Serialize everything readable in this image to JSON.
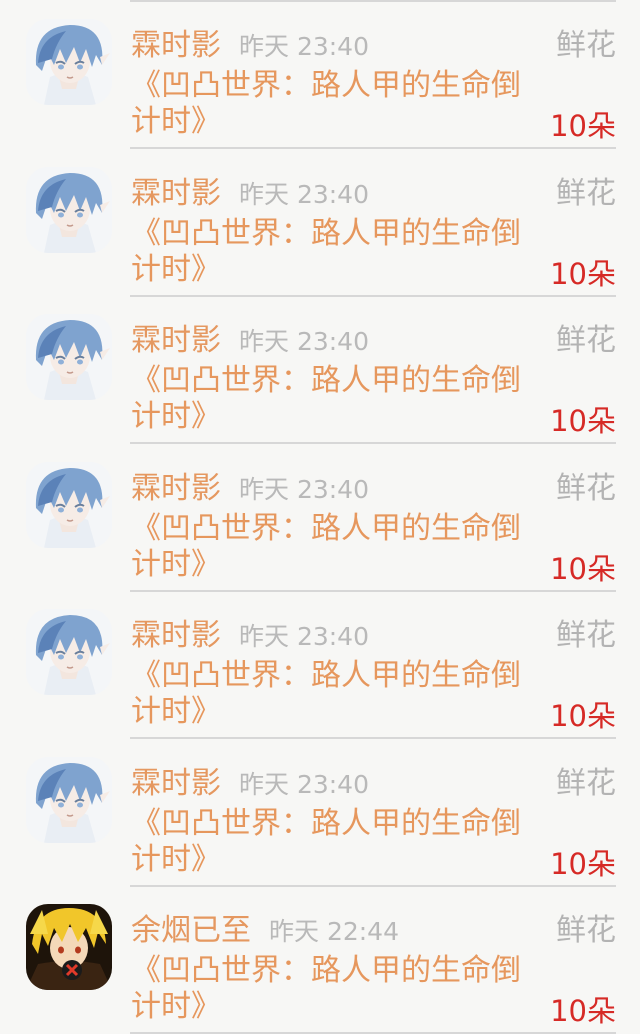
{
  "gifts": [
    {
      "user": "霖时影",
      "time": "昨天 23:40",
      "gift_label": "鲜花",
      "work_title": "《凹凸世界：路人甲的生命倒计时》",
      "count": "10朵",
      "avatar": "blue-hair-avatar"
    },
    {
      "user": "霖时影",
      "time": "昨天 23:40",
      "gift_label": "鲜花",
      "work_title": "《凹凸世界：路人甲的生命倒计时》",
      "count": "10朵",
      "avatar": "blue-hair-avatar"
    },
    {
      "user": "霖时影",
      "time": "昨天 23:40",
      "gift_label": "鲜花",
      "work_title": "《凹凸世界：路人甲的生命倒计时》",
      "count": "10朵",
      "avatar": "blue-hair-avatar"
    },
    {
      "user": "霖时影",
      "time": "昨天 23:40",
      "gift_label": "鲜花",
      "work_title": "《凹凸世界：路人甲的生命倒计时》",
      "count": "10朵",
      "avatar": "blue-hair-avatar"
    },
    {
      "user": "霖时影",
      "time": "昨天 23:40",
      "gift_label": "鲜花",
      "work_title": "《凹凸世界：路人甲的生命倒计时》",
      "count": "10朵",
      "avatar": "blue-hair-avatar"
    },
    {
      "user": "霖时影",
      "time": "昨天 23:40",
      "gift_label": "鲜花",
      "work_title": "《凹凸世界：路人甲的生命倒计时》",
      "count": "10朵",
      "avatar": "blue-hair-avatar"
    },
    {
      "user": "余烟已至",
      "time": "昨天 22:44",
      "gift_label": "鲜花",
      "work_title": "《凹凸世界：路人甲的生命倒计时》",
      "count": "10朵",
      "avatar": "yellow-hair-avatar"
    }
  ],
  "colors": {
    "user_name": "#e59860",
    "time": "#b9b9b9",
    "gift_label": "#b3b3b3",
    "work_title": "#e6975d",
    "gift_count": "#d62a26",
    "divider": "#d7d7d7",
    "background": "#f7f7f5"
  }
}
